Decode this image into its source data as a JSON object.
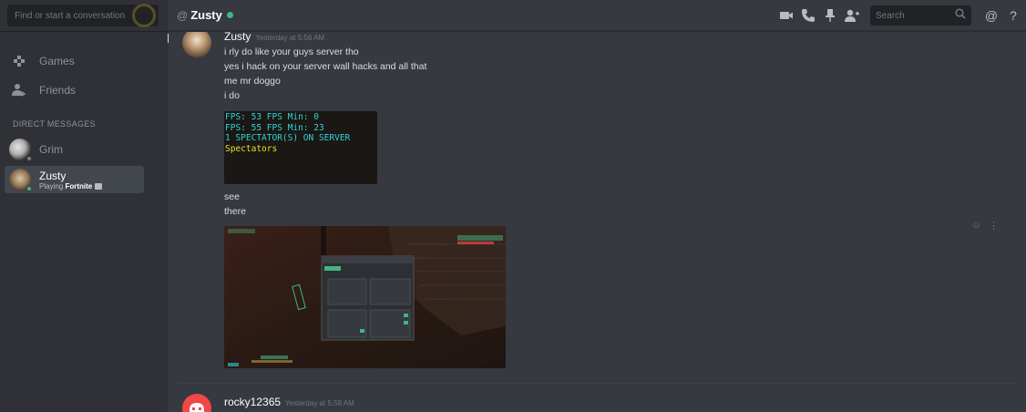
{
  "sidebar": {
    "search_placeholder": "Find or start a conversation",
    "nav": [
      {
        "label": "Games",
        "icon": "controller-icon"
      },
      {
        "label": "Friends",
        "icon": "friends-icon"
      }
    ],
    "dm_header": "DIRECT MESSAGES",
    "dms": [
      {
        "name": "Grim",
        "status": "offline"
      },
      {
        "name": "Zusty",
        "status": "online",
        "activity_prefix": "Playing",
        "activity_game": "Fortnite"
      }
    ]
  },
  "header": {
    "at": "@",
    "title": "Zusty",
    "search_placeholder": "Search"
  },
  "messages": [
    {
      "author": "Zusty",
      "timestamp": "Yesterday at 5:56 AM",
      "lines": [
        "i rly do like your guys server tho",
        "yes i hack on your server wall hacks and all that",
        "me mr doggo",
        "i do"
      ],
      "embed_text": [
        "FPS: 53  FPS Min: 0",
        "FPS: 55  FPS Min: 23",
        "1 SPECTATOR(S) ON SERVER",
        "Spectators"
      ],
      "after_lines": [
        "see",
        "there"
      ]
    },
    {
      "author": "rocky12365",
      "timestamp": "Yesterday at 5:58 AM"
    }
  ],
  "colors": {
    "online": "#43b581",
    "sidebar_bg": "#2f3136",
    "chat_bg": "#36393f",
    "rocky_avatar": "#f04747"
  }
}
